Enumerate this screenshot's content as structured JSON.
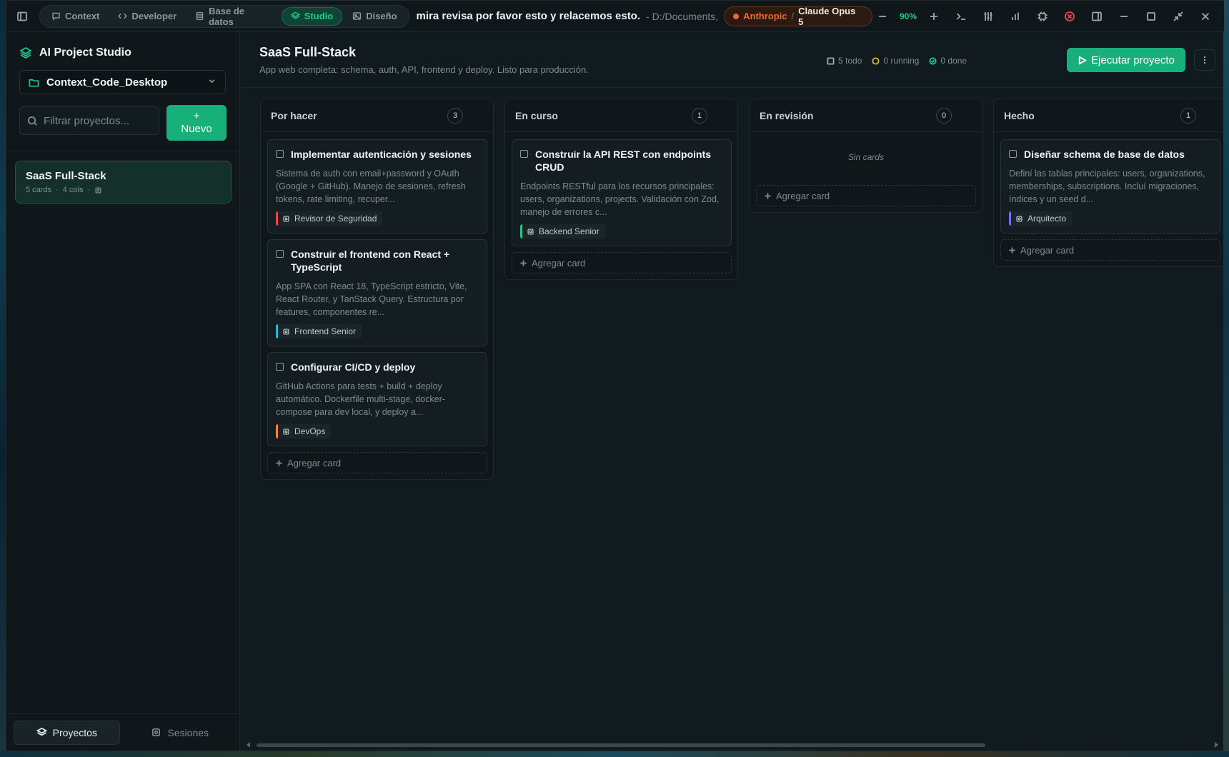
{
  "titlebar": {
    "nav_tabs": [
      {
        "label": "Context",
        "icon": "chat-icon"
      },
      {
        "label": "Developer",
        "icon": "code-icon"
      },
      {
        "label": "Base de datos",
        "icon": "database-icon"
      },
      {
        "label": "Studio",
        "icon": "layers-icon",
        "active": true
      },
      {
        "label": "Diseño",
        "icon": "image-icon"
      }
    ],
    "session_title": "mira revisa por favor esto y relacemos esto.",
    "session_path": "- D:/Documents,",
    "model_provider": "Anthropic",
    "model_separator": "/",
    "model_name": "Claude Opus 5",
    "zoom": "90%"
  },
  "sidebar": {
    "brand": "AI Project Studio",
    "workspace": "Context_Code_Desktop",
    "filter_placeholder": "Filtrar proyectos...",
    "new_button_plus": "+",
    "new_button_label": "Nuevo",
    "projects": [
      {
        "name": "SaaS Full-Stack",
        "cards": "5 cards",
        "cols": "4 cols",
        "dot": "·"
      }
    ],
    "bottom_tabs": [
      {
        "label": "Proyectos",
        "active": true
      },
      {
        "label": "Sesiones",
        "active": false
      }
    ]
  },
  "main": {
    "title": "SaaS Full-Stack",
    "subtitle": "App web completa: schema, auth, API, frontend y deploy. Listo para producción.",
    "stats": {
      "todo": "5 todo",
      "running": "0 running",
      "done": "0 done"
    },
    "run_button": "Ejecutar proyecto",
    "add_card_label": "Agregar card",
    "empty_label": "Sin cards",
    "columns": [
      {
        "title": "Por hacer",
        "count": "3",
        "cards": [
          {
            "title": "Implementar autenticación y sesiones",
            "desc": "Sistema de auth con email+password y OAuth (Google + GitHub). Manejo de sesiones, refresh tokens, rate limiting, recuper...",
            "agent": "Revisor de Seguridad",
            "agent_color": "#e5484d"
          },
          {
            "title": "Construir el frontend con React + TypeScript",
            "desc": "App SPA con React 18, TypeScript estricto, Vite, React Router, y TanStack Query. Estructura por features, componentes re...",
            "agent": "Frontend Senior",
            "agent_color": "#2bb3d9"
          },
          {
            "title": "Configurar CI/CD y deploy",
            "desc": "GitHub Actions para tests + build + deploy automático. Dockerfile multi-stage, docker-compose para dev local, y deploy a...",
            "agent": "DevOps",
            "agent_color": "#f2882a"
          }
        ]
      },
      {
        "title": "En curso",
        "count": "1",
        "cards": [
          {
            "title": "Construir la API REST con endpoints CRUD",
            "desc": "Endpoints RESTful para los recursos principales: users, organizations, projects. Validación con Zod, manejo de errores c...",
            "agent": "Backend Senior",
            "agent_color": "#1fc98b"
          }
        ]
      },
      {
        "title": "En revisión",
        "count": "0",
        "cards": []
      },
      {
        "title": "Hecho",
        "count": "1",
        "cards": [
          {
            "title": "Diseñar schema de base de datos",
            "desc": "Definí las tablas principales: users, organizations, memberships, subscriptions. Incluí migraciones, índices y un seed d...",
            "agent": "Arquitecto",
            "agent_color": "#7a6cf0"
          }
        ]
      }
    ]
  }
}
